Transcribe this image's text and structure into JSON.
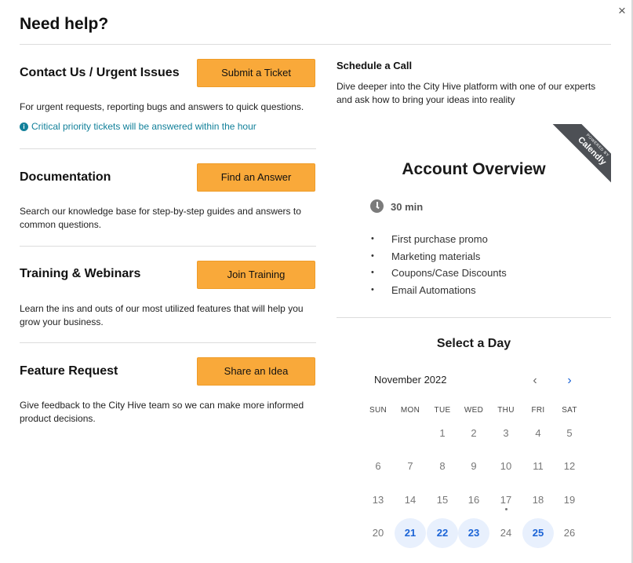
{
  "modal": {
    "title": "Need help?",
    "close_label": "×"
  },
  "sections": [
    {
      "title": "Contact Us / Urgent Issues",
      "button": "Submit a Ticket",
      "description": "For urgent requests, reporting bugs and answers to quick questions.",
      "note": "Critical priority tickets will be answered within the hour"
    },
    {
      "title": "Documentation",
      "button": "Find an Answer",
      "description": "Search our knowledge base for step-by-step guides and answers to common questions."
    },
    {
      "title": "Training & Webinars",
      "button": "Join Training",
      "description": "Learn the ins and outs of our most utilized features that will help you grow your business."
    },
    {
      "title": "Feature Request",
      "button": "Share an Idea",
      "description": "Give feedback to the City Hive team so we can make more informed product decisions."
    }
  ],
  "schedule": {
    "title": "Schedule a Call",
    "description": "Dive deeper into the City Hive platform with one of our experts and ask how to bring your ideas into reality"
  },
  "calendly": {
    "ribbon_small": "POWERED BY",
    "ribbon_brand": "Calendly",
    "event_title": "Account Overview",
    "duration": "30 min",
    "agenda": [
      "First purchase promo",
      "Marketing materials",
      "Coupons/Case Discounts",
      "Email Automations"
    ],
    "select_day_title": "Select a Day",
    "month_label": "November 2022",
    "prev_icon": "‹",
    "next_icon": "›",
    "weekdays": [
      "SUN",
      "MON",
      "TUE",
      "WED",
      "THU",
      "FRI",
      "SAT"
    ],
    "weeks": [
      [
        "",
        "",
        "1",
        "2",
        "3",
        "4",
        "5"
      ],
      [
        "6",
        "7",
        "8",
        "9",
        "10",
        "11",
        "12"
      ],
      [
        "13",
        "14",
        "15",
        "16",
        "17",
        "18",
        "19"
      ],
      [
        "20",
        "21",
        "22",
        "23",
        "24",
        "25",
        "26"
      ]
    ],
    "available_days": [
      "21",
      "22",
      "23",
      "25"
    ],
    "today": "17",
    "accent_color": "#1a63d6",
    "button_color": "#f9a93a"
  }
}
